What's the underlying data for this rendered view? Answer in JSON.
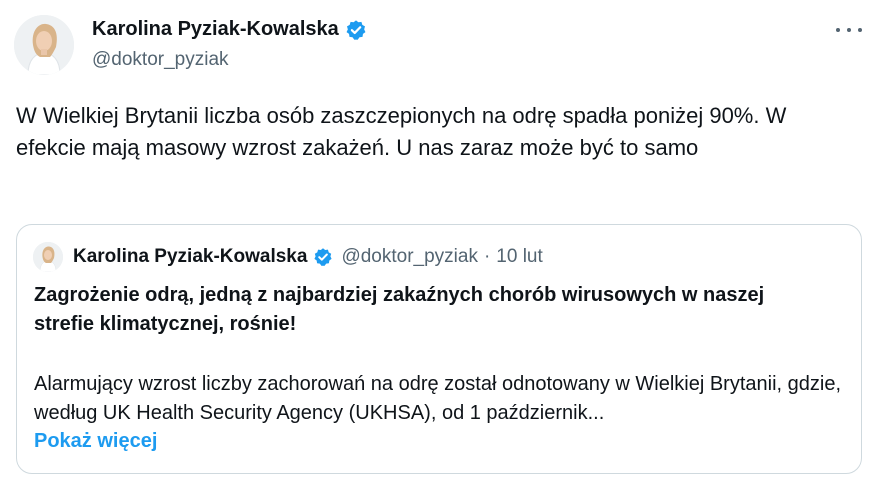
{
  "author": {
    "name": "Karolina Pyziak-Kowalska",
    "handle": "@doktor_pyziak"
  },
  "tweet": {
    "text": "W Wielkiej Brytanii liczba osób zaszczepionych na odrę spadła poniżej 90%. W efekcie mają masowy wzrost zakażeń. U nas zaraz może być to samo"
  },
  "quote": {
    "name": "Karolina Pyziak-Kowalska",
    "handle": "@doktor_pyziak",
    "separator": "·",
    "date": "10 lut",
    "title": "Zagrożenie odrą, jedną z najbardziej zakaźnych chorób wirusowych w naszej strefie klimatycznej, rośnie!",
    "body": "Alarmujący wzrost liczby zachorowań na odrę został odnotowany w Wielkiej Brytanii, gdzie, według UK Health Security Agency (UKHSA), od 1 październik...",
    "show_more": "Pokaż więcej"
  },
  "icons": {
    "verified": "verified-badge-icon",
    "more": "more-options-icon"
  },
  "colors": {
    "accent": "#1d9bf0",
    "text": "#0f1419",
    "secondary": "#536471",
    "border": "#cfd9de"
  }
}
